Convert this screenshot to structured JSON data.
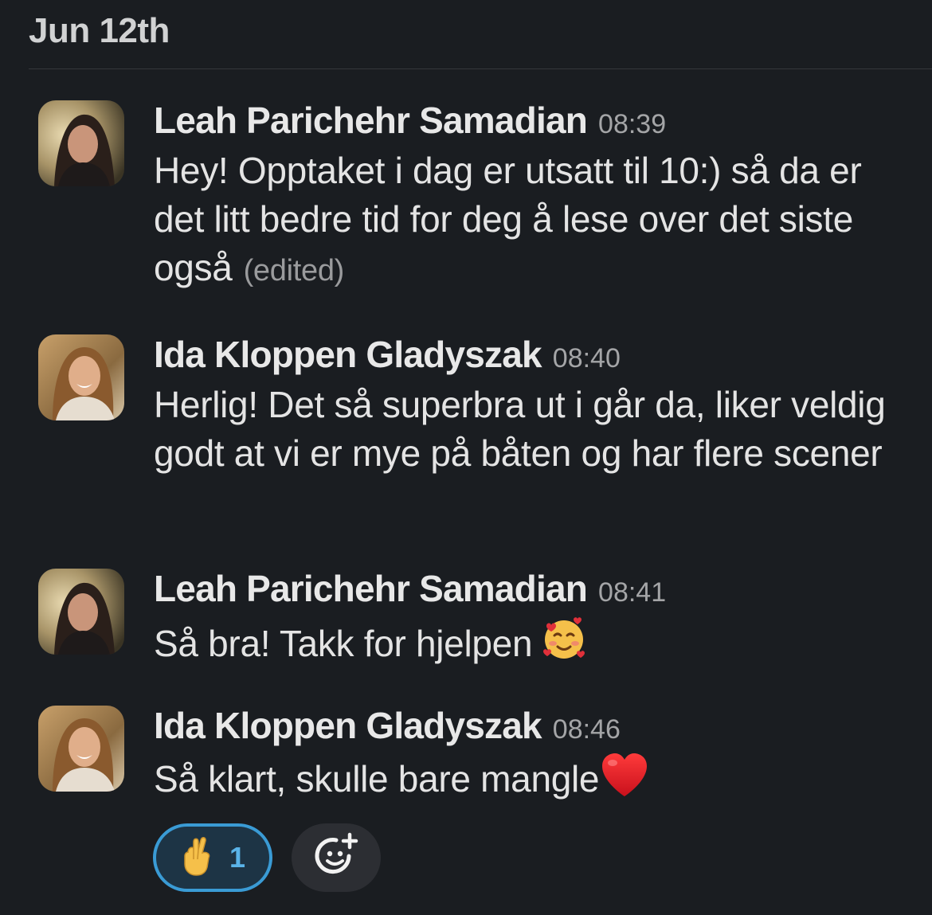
{
  "date_header": "Jun 12th",
  "messages": [
    {
      "author": "Leah Parichehr Samadian",
      "time": "08:39",
      "text": "Hey! Opptaket i dag er utsatt til 10:) så da er det litt bedre tid for deg å lese over det siste også",
      "edited_label": "(edited)"
    },
    {
      "author": "Ida Kloppen Gladyszak",
      "time": "08:40",
      "text": "Herlig! Det så superbra ut i går da, liker veldig godt at vi er mye på båten og har flere scener"
    },
    {
      "author": "Leah Parichehr Samadian",
      "time": "08:41",
      "text": "Så bra! Takk for hjelpen",
      "emoji": "smiling-face-with-hearts"
    },
    {
      "author": "Ida Kloppen Gladyszak",
      "time": "08:46",
      "text": "Så klart, skulle bare mangle",
      "emoji": "red-heart"
    }
  ],
  "reactions": [
    {
      "emoji": "crossed-fingers",
      "count": "1"
    }
  ],
  "add_reaction_icon": "add-reaction-icon",
  "colors": {
    "background": "#1a1d21",
    "reaction_border": "#3a9bd5",
    "reaction_count": "#5ab3e8"
  }
}
